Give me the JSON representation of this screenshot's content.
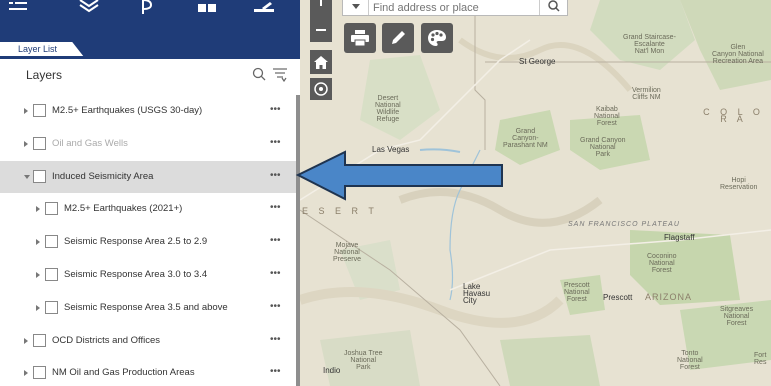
{
  "panel": {
    "tab_label": "Layer List",
    "title": "Layers",
    "more_label": "•••",
    "layers": [
      {
        "label": "M2.5+ Earthquakes (USGS 30-day)",
        "level": 0,
        "expanded": false,
        "faded": false,
        "selected": false,
        "checked": false
      },
      {
        "label": "Oil and Gas Wells",
        "level": 0,
        "expanded": false,
        "faded": true,
        "selected": false,
        "checked": false
      },
      {
        "label": "Induced Seismicity Area",
        "level": 0,
        "expanded": true,
        "faded": false,
        "selected": true,
        "checked": false
      },
      {
        "label": "M2.5+ Earthquakes (2021+)",
        "level": 1,
        "expanded": false,
        "faded": false,
        "selected": false,
        "checked": false
      },
      {
        "label": "Seismic Response Area 2.5 to 2.9",
        "level": 1,
        "expanded": false,
        "faded": false,
        "selected": false,
        "checked": false
      },
      {
        "label": "Seismic Response Area 3.0 to 3.4",
        "level": 1,
        "expanded": false,
        "faded": false,
        "selected": false,
        "checked": false
      },
      {
        "label": "Seismic Response Area 3.5 and above",
        "level": 1,
        "expanded": false,
        "faded": false,
        "selected": false,
        "checked": false
      },
      {
        "label": "OCD Districts and Offices",
        "level": 0,
        "expanded": false,
        "faded": false,
        "selected": false,
        "checked": false
      },
      {
        "label": "NM Oil and Gas Production Areas",
        "level": 0,
        "expanded": false,
        "faded": false,
        "selected": false,
        "checked": false
      }
    ]
  },
  "search": {
    "placeholder": "Find address or place"
  },
  "map": {
    "labels": {
      "st_george": "St George",
      "grand_staircase": "Grand Staircase-\nEscalante\nNat'l Mon",
      "glen_canyon": "Glen\nCanyon National\nRecreation Area",
      "vermilion": "Vermilion\nCliffs NM",
      "kaibab": "Kaibab\nNational\nForest",
      "colorado": "C O L O R A",
      "desert_refuge": "Desert\nNational\nWildlife\nRefuge",
      "grand_canyon_parashant": "Grand\nCanyon-\nParashant NM",
      "grand_canyon_np": "Grand Canyon\nNational\nPark",
      "las_vegas": "Las Vegas",
      "hopi": "Hopi\nReservation",
      "desert": "E S E R T",
      "mojave": "Mojave\nNational\nPreserve",
      "sf_plateau": "SAN FRANCISCO PLATEAU",
      "flagstaff": "Flagstaff",
      "coconino": "Coconino\nNational\nForest",
      "lake_havasu": "Lake\nHavasu\nCity",
      "prescott_nf": "Prescott\nNational\nForest",
      "prescott": "Prescott",
      "arizona": "ARIZONA",
      "sitgreaves": "Sitgreaves\nNational\nForest",
      "joshua_tree": "Joshua Tree\nNational\nPark",
      "tonto": "Tonto\nNational\nForest",
      "fort": "Fort\nRes",
      "indio": "Indio"
    }
  },
  "colors": {
    "header_blue": "#1f3c78",
    "arrow_blue": "#4a86c8",
    "map_bg": "#e7e2d2",
    "green_land": "#c9d8b3"
  }
}
